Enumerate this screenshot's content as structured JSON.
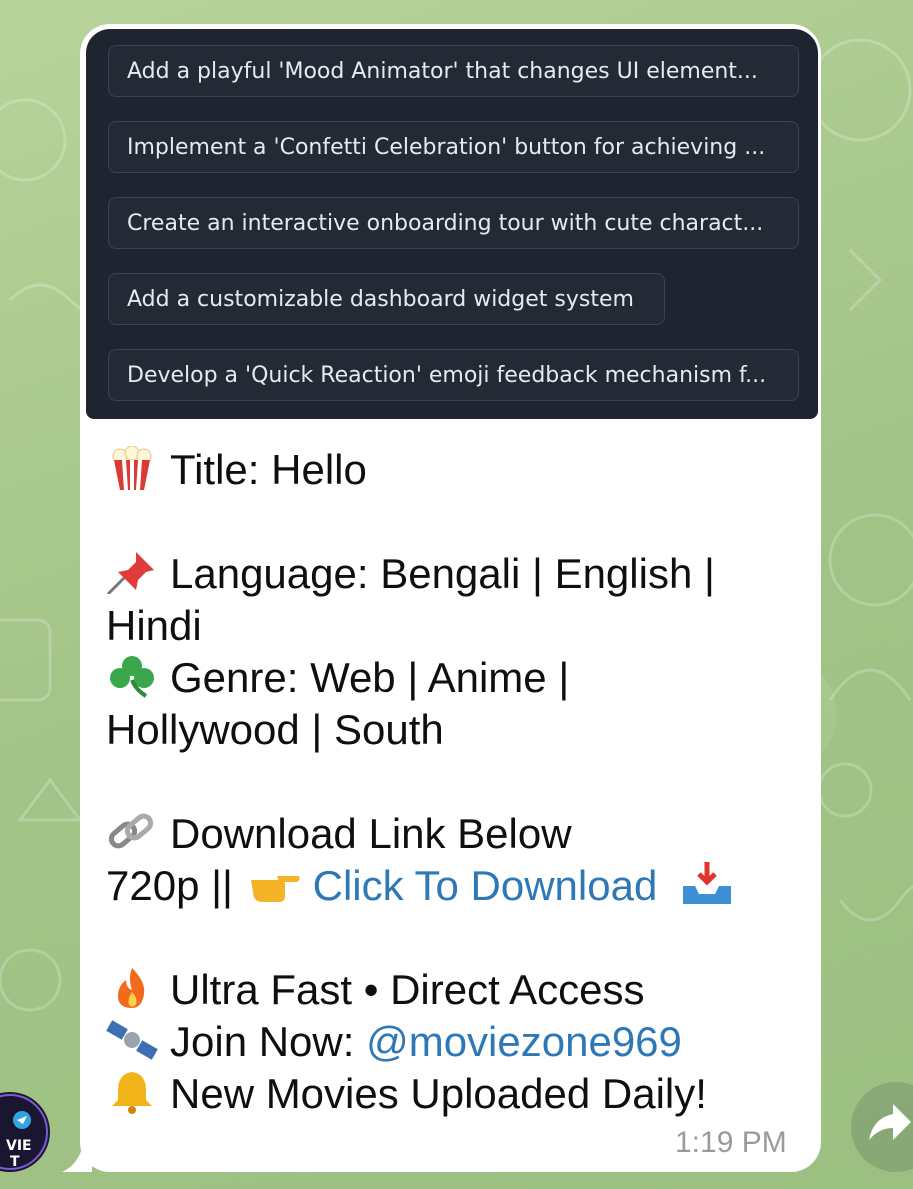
{
  "suggestions": [
    "Add a playful 'Mood Animator' that changes UI element...",
    "Implement a 'Confetti Celebration' button for achieving ...",
    "Create an interactive onboarding tour with cute charact...",
    "Add a customizable dashboard widget system",
    "Develop a 'Quick Reaction' emoji feedback mechanism f..."
  ],
  "message": {
    "title": "Title: Hello",
    "language_line1": "Language: Bengali | English |",
    "language_line2": "Hindi",
    "genre_line1": "Genre: Web | Anime |",
    "genre_line2": "Hollywood | South",
    "download_heading": "Download Link Below",
    "quality_prefix": "720p ||",
    "download_link": "Click To Download",
    "speed_line": "Ultra Fast • Direct Access",
    "join_prefix": "Join Now:",
    "join_handle": "@moviezone969",
    "daily_line": "New Movies Uploaded Daily!",
    "time": "1:19 PM"
  },
  "avatar_text": "VIE\nT",
  "icons": [
    "popcorn-icon",
    "pushpin-icon",
    "shamrock-icon",
    "link-icon",
    "pointing-hand-icon",
    "inbox-tray-icon",
    "fire-icon",
    "satellite-icon",
    "bell-icon",
    "share-arrow-icon"
  ],
  "colors": {
    "link": "#2e78b7",
    "panel": "#1e2430",
    "bubble": "#ffffff"
  }
}
